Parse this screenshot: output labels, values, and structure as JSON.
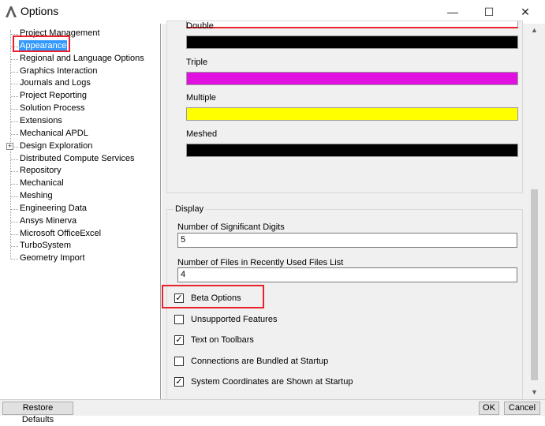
{
  "window": {
    "title": "Options",
    "minimize": "—",
    "maximize": "☐",
    "close": "✕"
  },
  "tree": {
    "items": [
      {
        "label": "Project Management"
      },
      {
        "label": "Appearance",
        "selected": true
      },
      {
        "label": "Regional and Language Options"
      },
      {
        "label": "Graphics Interaction"
      },
      {
        "label": "Journals and Logs"
      },
      {
        "label": "Project Reporting"
      },
      {
        "label": "Solution Process"
      },
      {
        "label": "Extensions"
      },
      {
        "label": "Mechanical APDL"
      },
      {
        "label": "Design Exploration",
        "expander": "+"
      },
      {
        "label": "Distributed Compute Services"
      },
      {
        "label": "Repository"
      },
      {
        "label": "Mechanical"
      },
      {
        "label": "Meshing"
      },
      {
        "label": "Engineering Data"
      },
      {
        "label": "Ansys Minerva"
      },
      {
        "label": "Microsoft OfficeExcel"
      },
      {
        "label": "TurboSystem"
      },
      {
        "label": "Geometry Import"
      }
    ]
  },
  "colors": {
    "items": [
      {
        "label": "Double",
        "color": "#000000"
      },
      {
        "label": "Triple",
        "color": "#e010e0"
      },
      {
        "label": "Multiple",
        "color": "#ffff00"
      },
      {
        "label": "Meshed",
        "color": "#000000"
      }
    ],
    "partial_top_color": "#ffffff",
    "highlight_color": "#e8212a"
  },
  "display": {
    "legend": "Display",
    "significant_digits_label": "Number of Significant Digits",
    "significant_digits_value": "5",
    "recent_files_label": "Number of Files in Recently Used Files List",
    "recent_files_value": "4",
    "checkboxes": [
      {
        "label": "Beta Options",
        "checked": true
      },
      {
        "label": "Unsupported Features",
        "checked": false
      },
      {
        "label": "Text on Toolbars",
        "checked": true
      },
      {
        "label": "Connections are Bundled at Startup",
        "checked": false
      },
      {
        "label": "System Coordinates are Shown at Startup",
        "checked": true
      }
    ]
  },
  "buttons": {
    "restore_defaults": "Restore Defaults",
    "ok": "OK",
    "cancel": "Cancel"
  }
}
